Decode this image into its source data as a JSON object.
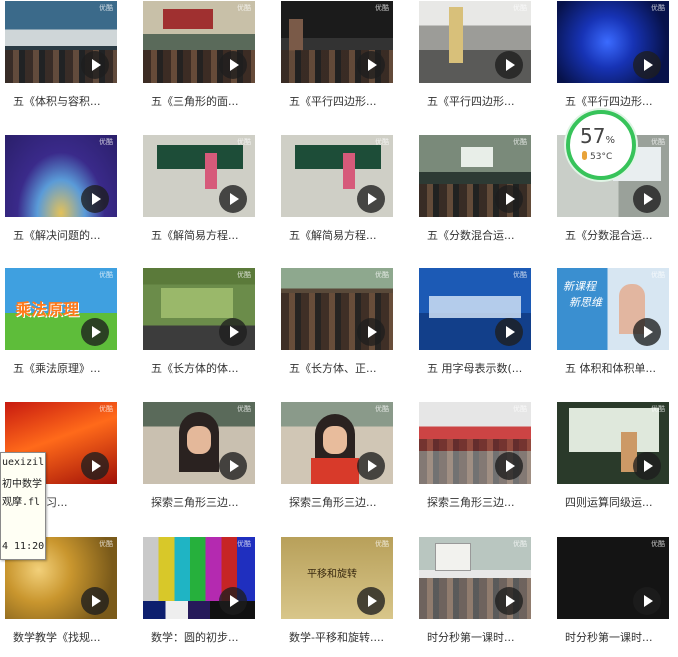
{
  "watermark": "优酷",
  "videos": [
    {
      "title": "五《体积与容积..."
    },
    {
      "title": "五《三角形的面..."
    },
    {
      "title": "五《平行四边形..."
    },
    {
      "title": "五《平行四边形..."
    },
    {
      "title": "五《平行四边形..."
    },
    {
      "title": "五《解决问题的..."
    },
    {
      "title": "五《解简易方程..."
    },
    {
      "title": "五《解简易方程..."
    },
    {
      "title": "五《分数混合运..."
    },
    {
      "title": "五《分数混合运..."
    },
    {
      "title": "五《乘法原理》..."
    },
    {
      "title": "五《长方体的体..."
    },
    {
      "title": "五《长方体、正..."
    },
    {
      "title": "五 用字母表示数(..."
    },
    {
      "title": "五 体积和体积单..."
    },
    {
      "title": "边形复习..."
    },
    {
      "title": "探索三角形三边..."
    },
    {
      "title": "探索三角形三边..."
    },
    {
      "title": "探索三角形三边..."
    },
    {
      "title": "四则运算同级运..."
    },
    {
      "title": "数学教学《找规..."
    },
    {
      "title": "数学：圆的初步..."
    },
    {
      "title": "数学-平移和旋转...."
    },
    {
      "title": "时分秒第一课时..."
    },
    {
      "title": "时分秒第一课时..."
    }
  ],
  "thumb_text": {
    "v10": "乘法原理",
    "v14a": "新课程",
    "v14b": "新思维",
    "v21": "平移和旋转"
  },
  "system_badge": {
    "percent": "57",
    "percent_unit": "%",
    "temperature": "53°C",
    "ring_color": "#37c35a"
  },
  "tooltip": {
    "lines": [
      "uexizil",
      "初中数学",
      "观摩.fl",
      "",
      "4 11:20"
    ]
  }
}
